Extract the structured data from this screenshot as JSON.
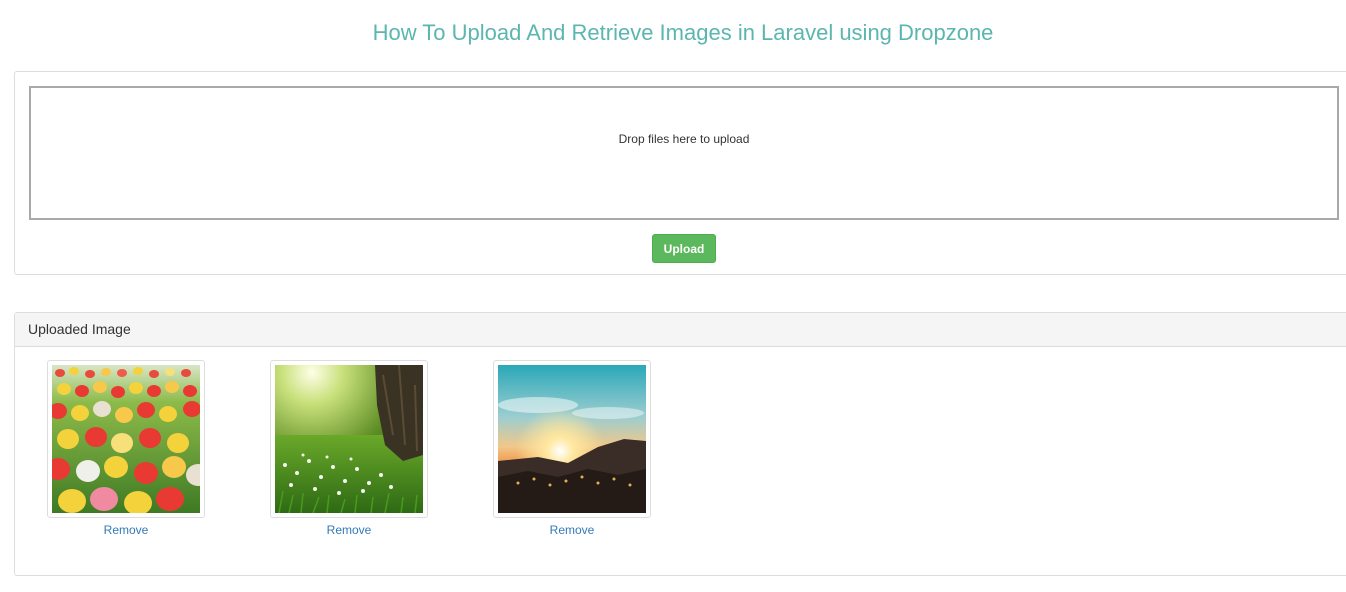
{
  "header": {
    "title": "How To Upload And Retrieve Images in Laravel using Dropzone",
    "title_color": "#5bb6b0"
  },
  "upload_panel": {
    "dropzone_message": "Drop files here to upload",
    "upload_button_label": "Upload",
    "upload_button_color": "#5cb85c"
  },
  "gallery": {
    "heading": "Uploaded Image",
    "images": [
      {
        "icon": "tulip-field-photo",
        "remove_label": "Remove"
      },
      {
        "icon": "forest-meadow-photo",
        "remove_label": "Remove"
      },
      {
        "icon": "mountain-sunset-photo",
        "remove_label": "Remove"
      }
    ],
    "link_color": "#337ab7"
  }
}
